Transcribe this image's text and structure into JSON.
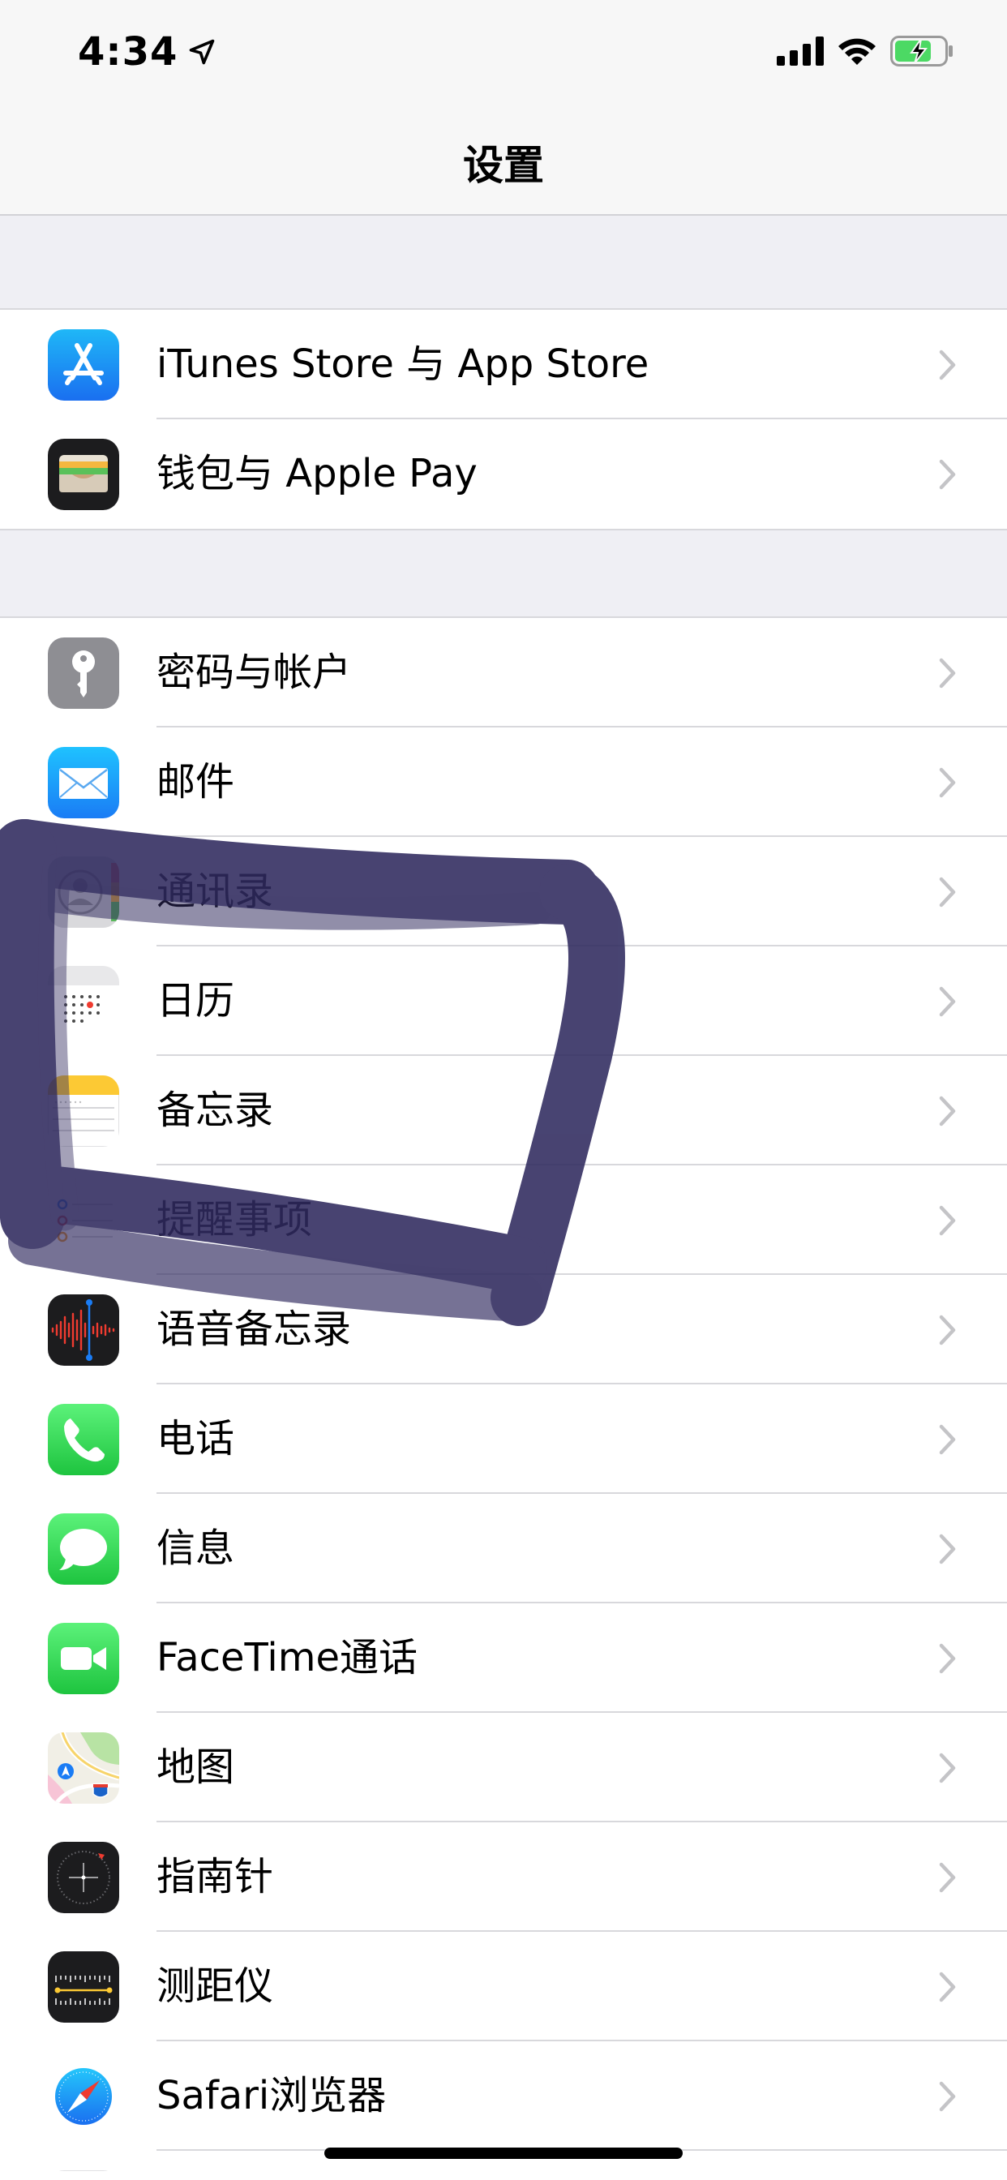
{
  "status": {
    "time": "4:34"
  },
  "nav": {
    "title": "设置"
  },
  "groups": [
    {
      "items": [
        {
          "label": "iTunes Store 与 App Store",
          "icon": "app-store-icon"
        },
        {
          "label": "钱包与 Apple Pay",
          "icon": "wallet-icon"
        }
      ]
    },
    {
      "items": [
        {
          "label": "密码与帐户",
          "icon": "key-icon"
        },
        {
          "label": "邮件",
          "icon": "mail-icon"
        },
        {
          "label": "通讯录",
          "icon": "contacts-icon"
        },
        {
          "label": "日历",
          "icon": "calendar-icon"
        },
        {
          "label": "备忘录",
          "icon": "notes-icon"
        },
        {
          "label": "提醒事项",
          "icon": "reminders-icon"
        },
        {
          "label": "语音备忘录",
          "icon": "voice-memos-icon"
        },
        {
          "label": "电话",
          "icon": "phone-icon"
        },
        {
          "label": "信息",
          "icon": "messages-icon"
        },
        {
          "label": "FaceTime通话",
          "icon": "facetime-icon"
        },
        {
          "label": "地图",
          "icon": "maps-icon"
        },
        {
          "label": "指南针",
          "icon": "compass-icon"
        },
        {
          "label": "测距仪",
          "icon": "measure-icon"
        },
        {
          "label": "Safari浏览器",
          "icon": "safari-icon"
        }
      ]
    }
  ],
  "colors": {
    "background": "#efeff4",
    "separator": "#d8d8dc",
    "chevron": "#c4c4c7",
    "scribble": "#2f2a5e",
    "battery": "#4cd964"
  }
}
